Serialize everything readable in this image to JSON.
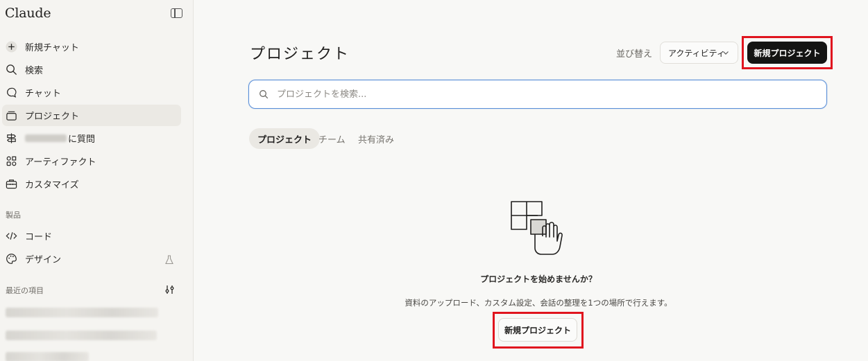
{
  "sidebar": {
    "brand": "Claude",
    "toggle_icon": "sidebar-toggle-icon",
    "items": [
      {
        "label": "新規チャット",
        "icon": "plus-circle-icon"
      },
      {
        "label": "検索",
        "icon": "search-icon"
      },
      {
        "label": "チャット",
        "icon": "chat-bubble-icon"
      },
      {
        "label": "プロジェクト",
        "icon": "folder-stack-icon",
        "active": true
      },
      {
        "label": "に質問",
        "icon": "signpost-icon"
      },
      {
        "label": "アーティファクト",
        "icon": "artifacts-icon"
      },
      {
        "label": "カスタマイズ",
        "icon": "toolbox-icon"
      }
    ],
    "products_label": "製品",
    "products": [
      {
        "label": "コード",
        "icon": "code-icon"
      },
      {
        "label": "デザイン",
        "icon": "palette-icon",
        "badge_icon": "flask-icon"
      }
    ],
    "recent_label": "最近の項目"
  },
  "main": {
    "title": "プロジェクト",
    "sort_label": "並び替え",
    "sort_value": "アクティビティ",
    "new_project_button": "新規プロジェクト",
    "search_placeholder": "プロジェクトを検索...",
    "tabs": [
      "プロジェクト",
      "チーム",
      "共有済み"
    ],
    "active_tab": 0,
    "empty_title": "プロジェクトを始めませんか？",
    "empty_desc": "資料のアップロード、カスタム設定、会話の整理を1つの場所で行えます。",
    "empty_button": "新規プロジェクト"
  },
  "colors": {
    "accent_dark": "#141413",
    "highlight_red": "#e0141e",
    "search_border": "#5a8fd8",
    "background": "#f8f8f6"
  }
}
